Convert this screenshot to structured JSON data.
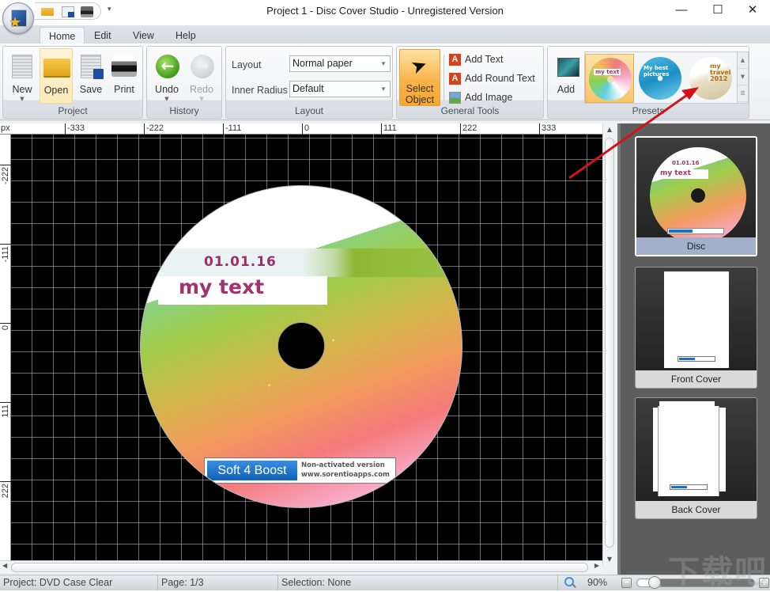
{
  "window": {
    "title": "Project 1 - Disc Cover Studio - Unregistered Version",
    "controls": {
      "minimize": "—",
      "maximize": "☐",
      "close": "✕"
    }
  },
  "quick_access": {
    "items": [
      {
        "name": "open",
        "icon": "folder-icon"
      },
      {
        "name": "save",
        "icon": "save-icon"
      },
      {
        "name": "print",
        "icon": "printer-icon"
      }
    ],
    "dropdown": "▾"
  },
  "ribbon": {
    "tabs": [
      {
        "label": "Home",
        "active": true
      },
      {
        "label": "Edit",
        "active": false
      },
      {
        "label": "View",
        "active": false
      },
      {
        "label": "Help",
        "active": false
      }
    ],
    "groups": {
      "project": {
        "label": "Project",
        "buttons": {
          "new": "New",
          "open": "Open",
          "save": "Save",
          "print": "Print"
        }
      },
      "history": {
        "label": "History",
        "buttons": {
          "undo": "Undo",
          "redo": "Redo"
        }
      },
      "layout": {
        "label": "Layout",
        "layout_label": "Layout",
        "layout_value": "Normal paper",
        "inner_radius_label": "Inner Radius",
        "inner_radius_value": "Default"
      },
      "general_tools": {
        "label": "General Tools",
        "select_object": "Select Object",
        "add_text": "Add Text",
        "add_round_text": "Add Round Text",
        "add_image": "Add Image"
      },
      "presets": {
        "label": "Presets",
        "add": "Add",
        "items": [
          {
            "name": "rainbow-disc",
            "text": "my text",
            "selected": true
          },
          {
            "name": "blue-disc",
            "text": "My best pictures",
            "selected": false
          },
          {
            "name": "travel-disc",
            "text": "my travel 2012",
            "selected": false
          }
        ]
      }
    }
  },
  "rulers": {
    "unit": "px",
    "horizontal_ticks": [
      "-333",
      "-222",
      "-111",
      "0",
      "111",
      "222",
      "333"
    ],
    "vertical_ticks": [
      "-222",
      "-111",
      "0",
      "111",
      "222"
    ]
  },
  "disc_design": {
    "date": "01.01.16",
    "title": "my text",
    "watermark_logo": "Soft 4 Boost",
    "watermark_line1": "Non-activated version",
    "watermark_line2": "www.sorentioapps.com"
  },
  "pages": [
    {
      "label": "Disc",
      "selected": true
    },
    {
      "label": "Front Cover",
      "selected": false
    },
    {
      "label": "Back Cover",
      "selected": false
    }
  ],
  "status": {
    "project": "Project: DVD Case Clear",
    "page": "Page: 1/3",
    "selection": "Selection: None",
    "zoom": "90%",
    "zoom_level_percent": 90
  },
  "overlay": {
    "site_watermark": "下载吧"
  }
}
